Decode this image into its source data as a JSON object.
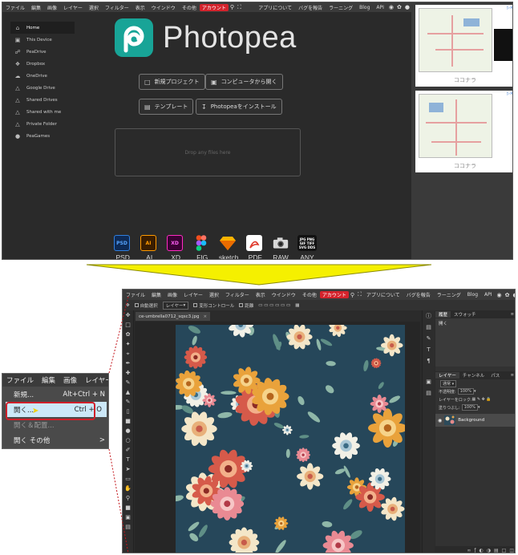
{
  "top": {
    "menubar": {
      "items": [
        "ファイル",
        "編集",
        "画像",
        "レイヤー",
        "選択",
        "フィルター",
        "表示",
        "ウインドウ",
        "その他"
      ],
      "account": "アカウント",
      "right_items": [
        "アプリについて",
        "バグを報告",
        "ラーニング",
        "Blog",
        "API"
      ]
    },
    "sidebar": {
      "items": [
        {
          "label": "Home",
          "icon": "home-icon"
        },
        {
          "label": "This Device",
          "icon": "monitor-icon"
        },
        {
          "label": "PeaDrive",
          "icon": "drive-icon"
        },
        {
          "label": "Dropbox",
          "icon": "dropbox-icon"
        },
        {
          "label": "OneDrive",
          "icon": "cloud-icon"
        },
        {
          "label": "Google Drive",
          "icon": "google-drive-icon"
        },
        {
          "label": "Shared Drives",
          "icon": "shared-drives-icon"
        },
        {
          "label": "Shared with me",
          "icon": "shared-icon"
        },
        {
          "label": "Private Folder",
          "icon": "folder-icon"
        },
        {
          "label": "PeaGames",
          "icon": "gamepad-icon"
        }
      ]
    },
    "logo_text": "Photopea",
    "buttons": {
      "new_project": "新規プロジェクト",
      "open_from_computer": "コンピュータから開く",
      "templates": "テンプレート",
      "install": "Photopeaをインストール"
    },
    "dropzone_text": "Drop any files here",
    "formats": [
      {
        "label": ".PSD",
        "icon_text": "PSD",
        "color": "#1b4fa0"
      },
      {
        "label": ".AI",
        "icon_text": "AI",
        "color": "#e0891a"
      },
      {
        "label": ".XD",
        "icon_text": "XD",
        "color": "#b01fb0"
      },
      {
        "label": ".FIG",
        "icon_text": "",
        "color": "#f24e1e"
      },
      {
        "label": ".sketch",
        "icon_text": "",
        "color": "#f7b500"
      },
      {
        "label": ".PDF",
        "icon_text": "",
        "color": "#e03b2e"
      },
      {
        "label": "RAW",
        "icon_text": "",
        "color": "#cccccc"
      },
      {
        "label": "ANY",
        "icon_text": "JPG PNG GIF TIFF SVG DDS",
        "color": "#111111"
      }
    ],
    "ads": [
      {
        "label": "ココナラ"
      },
      {
        "label": "ココナラ"
      }
    ]
  },
  "bottom": {
    "menubar": {
      "items": [
        "ファイル",
        "編集",
        "画像",
        "レイヤー",
        "選択",
        "フィルター",
        "表示",
        "ウインドウ",
        "その他"
      ],
      "account": "アカウント",
      "right_items": [
        "アプリについて",
        "バグを報告",
        "ラーニング",
        "Blog",
        "API"
      ]
    },
    "optbar": {
      "auto_select": "自動選択",
      "layer_select": "レイヤー",
      "transform_controls": "変形コントロール",
      "distance": "距離"
    },
    "doc_tab": "ce-umbrella0712_sqsc3.jpg",
    "history_panel": {
      "tabs": [
        "履歴",
        "スウォッチ"
      ],
      "item": "開く"
    },
    "layers_panel": {
      "tabs": [
        "レイヤー",
        "チャンネル",
        "パス"
      ],
      "blend_mode": "通常",
      "opacity_label": "不透明度:",
      "opacity_value": "100%",
      "lock_label": "レイヤーをロック:",
      "fill_label": "塗りつぶし:",
      "fill_value": "100%",
      "layer_name": "Background"
    }
  },
  "callout": {
    "menubar": [
      "ファイル",
      "編集",
      "画像",
      "レイヤー"
    ],
    "items": [
      {
        "label": "新規...",
        "shortcut": "Alt+Ctrl + N"
      },
      {
        "label": "開く...",
        "shortcut": "Ctrl + O"
      },
      {
        "label": "開く＆配置...",
        "shortcut": ""
      },
      {
        "label": "開く その他",
        "shortcut": ">"
      }
    ]
  },
  "colors": {
    "accent_teal": "#18a497",
    "account_red": "#d4232c",
    "arrow_yellow": "#f5f000",
    "highlight_ring": "#d0202a"
  }
}
